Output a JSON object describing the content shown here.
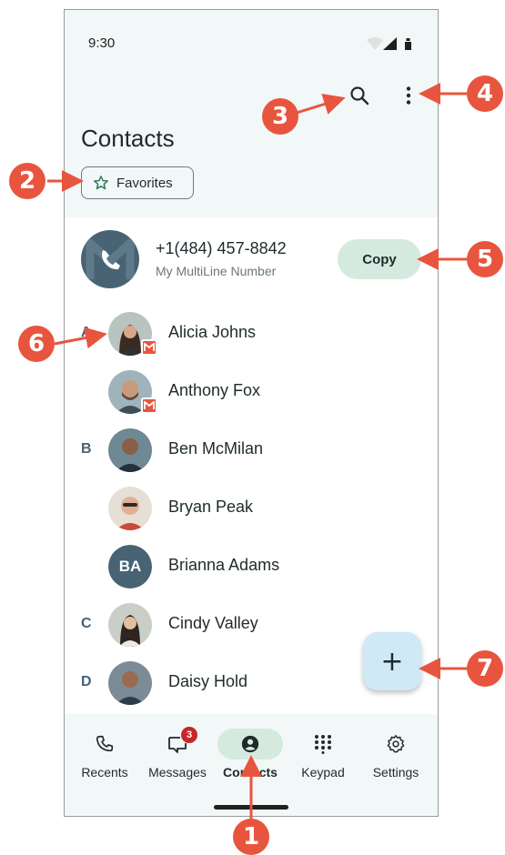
{
  "status_bar": {
    "time": "9:30"
  },
  "header": {
    "title": "Contacts",
    "favorites_chip": "Favorites"
  },
  "my_number": {
    "phone": "+1(484) 457-8842",
    "label": "My MultiLine Number",
    "copy_label": "Copy"
  },
  "contacts": [
    {
      "letter": "A",
      "name": "Alicia Johns",
      "multiline": true
    },
    {
      "letter": "",
      "name": "Anthony Fox",
      "multiline": true
    },
    {
      "letter": "B",
      "name": "Ben McMilan",
      "multiline": false
    },
    {
      "letter": "",
      "name": "Bryan Peak",
      "multiline": false
    },
    {
      "letter": "",
      "name": "Brianna Adams",
      "multiline": false,
      "initials": "BA"
    },
    {
      "letter": "C",
      "name": "Cindy Valley",
      "multiline": false
    },
    {
      "letter": "D",
      "name": "Daisy Hold",
      "multiline": false
    }
  ],
  "fab": {
    "icon": "plus-icon",
    "label": "+"
  },
  "bottom_nav": {
    "items": [
      {
        "label": "Recents",
        "icon": "phone-icon",
        "active": false
      },
      {
        "label": "Messages",
        "icon": "message-icon",
        "active": false,
        "badge": "3"
      },
      {
        "label": "Contacts",
        "icon": "person-icon",
        "active": true
      },
      {
        "label": "Keypad",
        "icon": "dialpad-icon",
        "active": false
      },
      {
        "label": "Settings",
        "icon": "gear-icon",
        "active": false
      }
    ]
  },
  "callouts": [
    "1",
    "2",
    "3",
    "4",
    "5",
    "6",
    "7"
  ],
  "colors": {
    "accent": "#d5eadf",
    "brand": "#476374",
    "callout": "#e8553e",
    "fab": "#cfe9f7",
    "badge": "#c62828"
  }
}
